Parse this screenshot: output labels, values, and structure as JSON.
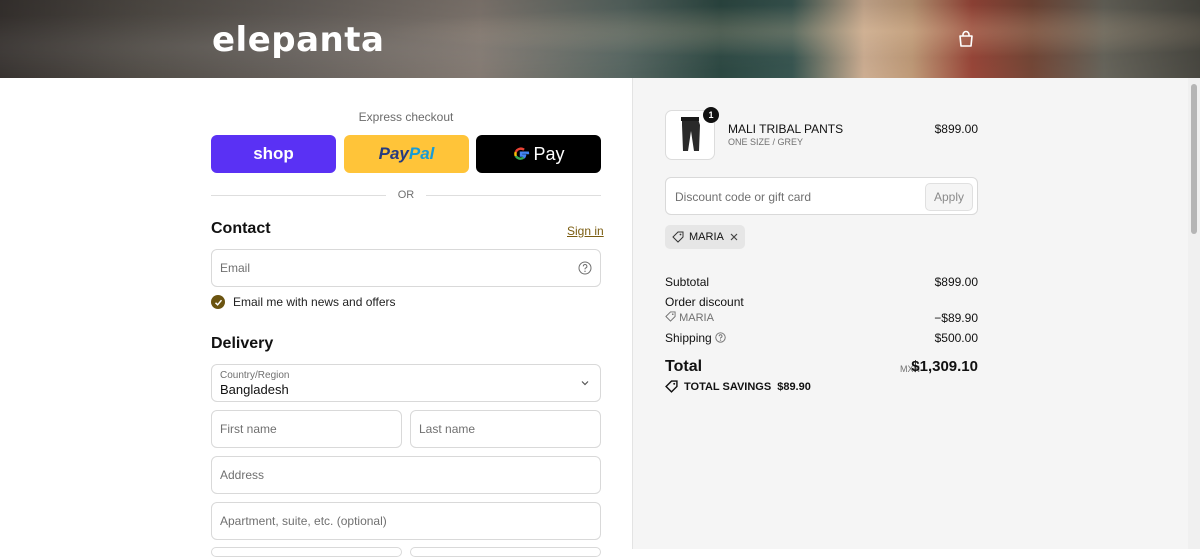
{
  "header": {
    "logo": "elepanta",
    "cart_icon": "shopping-bag-icon"
  },
  "express": {
    "title": "Express checkout",
    "shop_label": "shop",
    "paypal_label_1": "Pay",
    "paypal_label_2": "Pal",
    "gpay_label": "Pay",
    "or_label": "OR"
  },
  "contact": {
    "title": "Contact",
    "sign_in": "Sign in",
    "email_placeholder": "Email",
    "newsletter_label": "Email me with news and offers",
    "newsletter_checked": true
  },
  "delivery": {
    "title": "Delivery",
    "country_label": "Country/Region",
    "country_value": "Bangladesh",
    "first_name_placeholder": "First name",
    "last_name_placeholder": "Last name",
    "address_placeholder": "Address",
    "apartment_placeholder": "Apartment, suite, etc. (optional)"
  },
  "order": {
    "item": {
      "quantity": "1",
      "name": "MALI TRIBAL PANTS",
      "variant": "ONE SIZE / GREY",
      "price": "$899.00"
    },
    "discount_placeholder": "Discount code or gift card",
    "apply_label": "Apply",
    "applied_code": "MARIA",
    "subtotal_label": "Subtotal",
    "subtotal_value": "$899.00",
    "order_discount_label": "Order discount",
    "discount_code": "MARIA",
    "discount_value": "−$89.90",
    "shipping_label": "Shipping",
    "shipping_value": "$500.00",
    "total_label": "Total",
    "currency": "MXN",
    "total_value": "$1,309.10",
    "savings_label": "TOTAL SAVINGS",
    "savings_value": "$89.90"
  },
  "colors": {
    "shop": "#5a31f4",
    "paypal": "#ffc439",
    "gpay": "#000000",
    "accent": "#6b5410"
  }
}
